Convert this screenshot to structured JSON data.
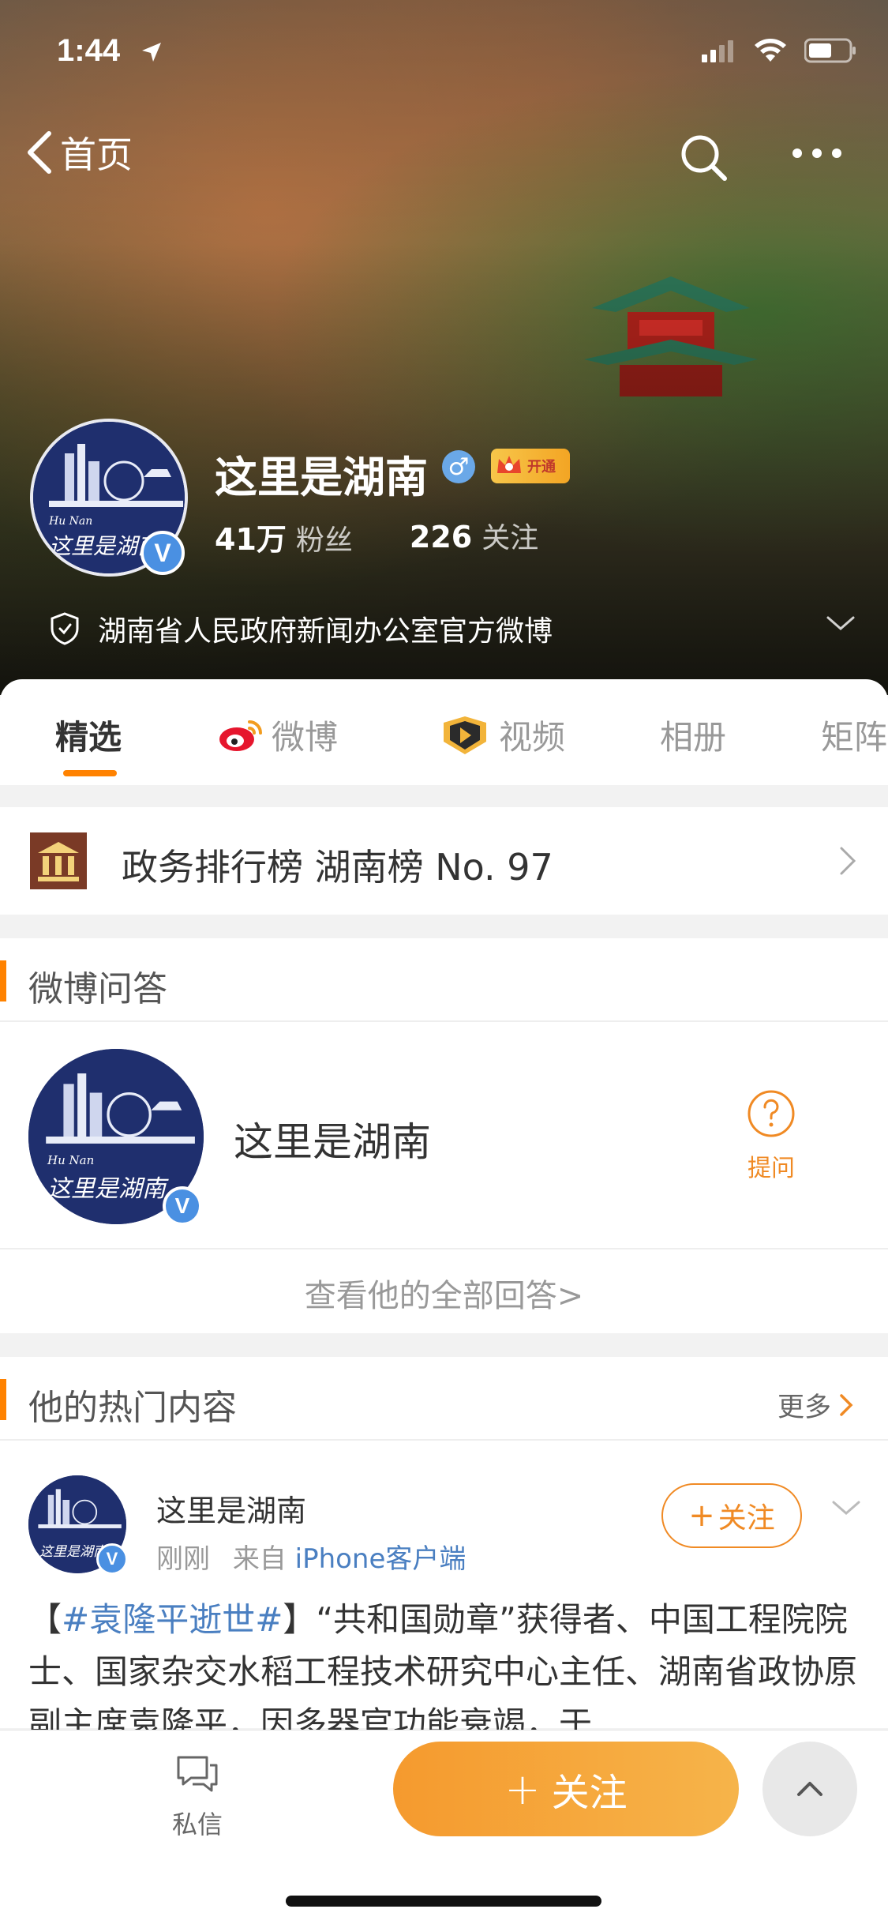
{
  "status": {
    "time": "1:44"
  },
  "nav": {
    "back_label": "首页"
  },
  "profile": {
    "name": "这里是湖南",
    "vip_label": "开通",
    "followers_count": "41万",
    "followers_label": "粉丝",
    "following_count": "226",
    "following_label": "关注",
    "official_desc": "湖南省人民政府新闻办公室官方微博",
    "avatar_caption_en": "Hu Nan",
    "avatar_caption_cn": "这里是湖南"
  },
  "tabs": [
    {
      "label": "精选"
    },
    {
      "label": "微博"
    },
    {
      "label": "视频"
    },
    {
      "label": "相册"
    },
    {
      "label": "矩阵"
    }
  ],
  "rank": {
    "text": "政务排行榜 湖南榜 No. 97"
  },
  "qa": {
    "title": "微博问答",
    "name": "这里是湖南",
    "ask_label": "提问",
    "view_all": "查看他的全部回答>"
  },
  "hot": {
    "title": "他的热门内容",
    "more_label": "更多",
    "post": {
      "author": "这里是湖南",
      "time": "刚刚",
      "from_prefix": "来自",
      "source": "iPhone客户端",
      "follow_label": "关注",
      "hashtag": "#袁隆平逝世#",
      "text_open": "【",
      "text_close": "】“共和国勋章”获得者、中国工程院院士、国家杂交水稻工程技术研究中心主任、湖南省政协原副主席袁隆平，因多器官功能衰竭，于"
    }
  },
  "bottom": {
    "dm_label": "私信",
    "follow_label": "关注"
  },
  "colors": {
    "accent": "#ff8200",
    "link": "#4a7fc1",
    "follow_gradient_start": "#f59a2e",
    "follow_gradient_end": "#f6b44a"
  }
}
